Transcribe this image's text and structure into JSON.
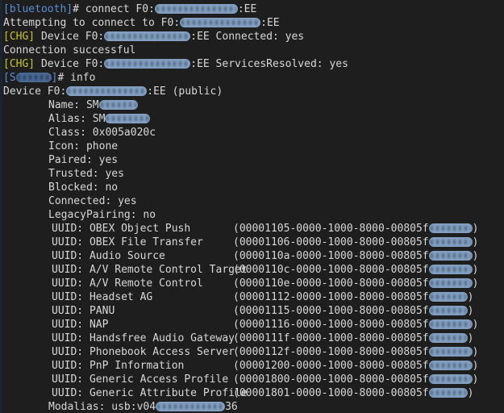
{
  "terminal": {
    "app": "bluetoothctl",
    "background_color": "#1e1e1e",
    "foreground_color": "#d8d8d8",
    "prompt_color": "#5a8fd6",
    "chg_color": "#c7c430",
    "redaction_color": "#8aa8cc"
  },
  "session": {
    "prompt_bluetooth": "[bluetooth]",
    "prompt_device": "[S",
    "prompt_device_close": "]",
    "hash": "#",
    "chg_tag": "[CHG]",
    "mac_prefix": "F0:",
    "mac_suffix": ":EE"
  },
  "lines": {
    "connect_cmd": " connect ",
    "attempting": "Attempting to connect to ",
    "chg_device": " Device ",
    "connected_yes": " Connected: yes",
    "connection_successful": "Connection successful",
    "services_resolved": " ServicesResolved: yes",
    "info_cmd": " info",
    "device_header": "Device ",
    "device_public": " (public)"
  },
  "info": [
    {
      "key": "Name:",
      "value": "SM",
      "redacted": true,
      "redact_class": "r-name"
    },
    {
      "key": "Alias:",
      "value": "SM",
      "redacted": true,
      "redact_class": "r-alias"
    },
    {
      "key": "Class:",
      "value": "0x005a020c",
      "redacted": false
    },
    {
      "key": "Icon:",
      "value": "phone",
      "redacted": false
    },
    {
      "key": "Paired:",
      "value": "yes",
      "redacted": false
    },
    {
      "key": "Trusted:",
      "value": "yes",
      "redacted": false
    },
    {
      "key": "Blocked:",
      "value": "no",
      "redacted": false
    },
    {
      "key": "Connected:",
      "value": "yes",
      "redacted": false
    },
    {
      "key": "LegacyPairing:",
      "value": "no",
      "redacted": false
    }
  ],
  "uuids": [
    {
      "label": "UUID: OBEX Object Push",
      "hex": "(00001105-0000-1000-8000-00805f",
      "tail": ")"
    },
    {
      "label": "UUID: OBEX File Transfer",
      "hex": "(00001106-0000-1000-8000-00805f",
      "tail": ")"
    },
    {
      "label": "UUID: Audio Source",
      "hex": "(0000110a-0000-1000-8000-00805f",
      "tail": ")"
    },
    {
      "label": "UUID: A/V Remote Control Target",
      "hex": "(0000110c-0000-1000-8000-00805f",
      "tail": ")"
    },
    {
      "label": "UUID: A/V Remote Control",
      "hex": "(0000110e-0000-1000-8000-00805f",
      "tail": ")"
    },
    {
      "label": "UUID: Headset AG",
      "hex": "(00001112-0000-1000-8000-00805f",
      "tail": ")"
    },
    {
      "label": "UUID: PANU",
      "hex": "(00001115-0000-1000-8000-00805f",
      "tail": ")"
    },
    {
      "label": "UUID: NAP",
      "hex": "(00001116-0000-1000-8000-00805f",
      "tail": ")"
    },
    {
      "label": "UUID: Handsfree Audio Gateway",
      "hex": "(0000111f-0000-1000-8000-00805f",
      "tail": ")"
    },
    {
      "label": "UUID: Phonebook Access Server",
      "hex": "(0000112f-0000-1000-8000-00805f",
      "tail": ")"
    },
    {
      "label": "UUID: PnP Information",
      "hex": "(00001200-0000-1000-8000-00805f",
      "tail": ")"
    },
    {
      "label": "UUID: Generic Access Profile",
      "hex": "(00001800-0000-1000-8000-00805f",
      "tail": ")"
    },
    {
      "label": "UUID: Generic Attribute Profile",
      "hex": "(00001801-0000-1000-8000-00805f",
      "tail": ")"
    }
  ],
  "modalias": {
    "key": "Modalias:",
    "prefix": "usb:v04",
    "suffix": "36"
  }
}
